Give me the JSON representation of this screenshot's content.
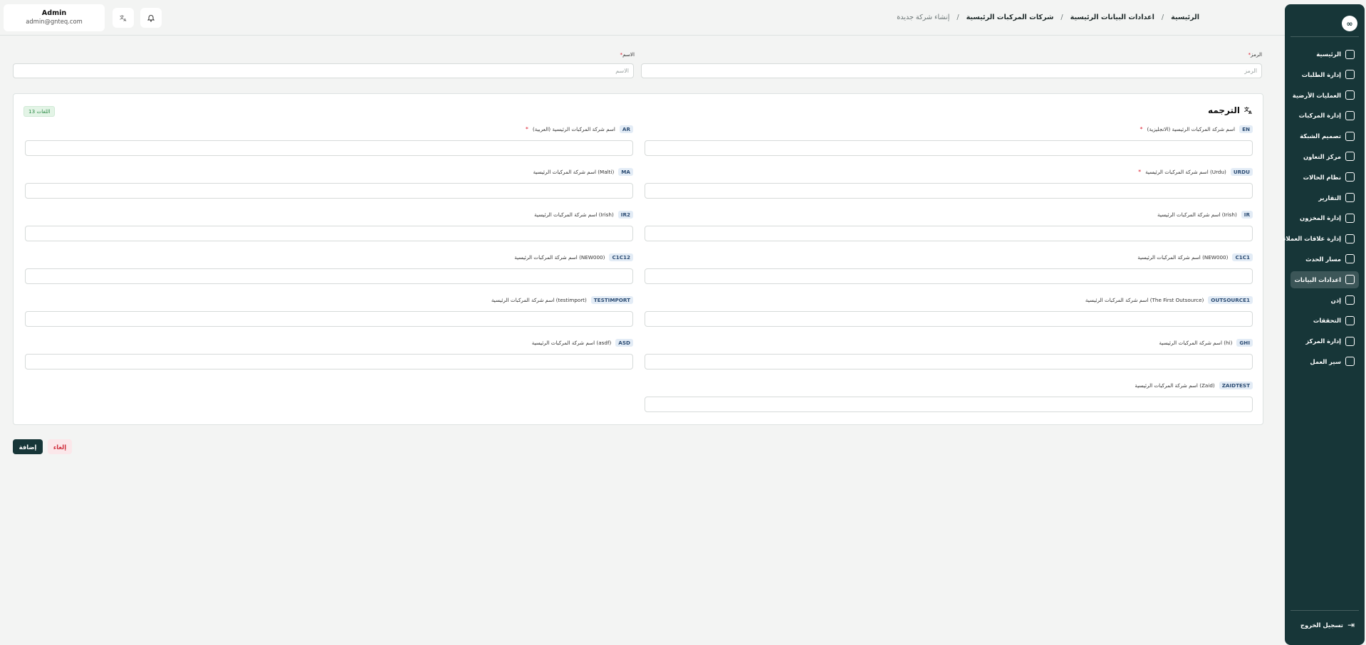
{
  "user": {
    "name": "Admin",
    "email": "admin@gnteq.com"
  },
  "topbar": {
    "translate_icon": "translate-icon",
    "bell_icon": "bell-icon"
  },
  "breadcrumb": {
    "items": [
      "الرئيسية",
      "اعدادات البيانات الرئيسية",
      "شركات المركبات الرئيسية",
      "إنشاء شركة جديدة"
    ],
    "separator": "/"
  },
  "sidebar": {
    "logo": "∞",
    "items": [
      {
        "label": "الرئيسية",
        "icon": "dashboard-icon"
      },
      {
        "label": "إدارة الطلبات",
        "icon": "orders-icon"
      },
      {
        "label": "العمليات الأرضية",
        "icon": "ground-ops-icon"
      },
      {
        "label": "إدارة المركبات",
        "icon": "truck-icon"
      },
      {
        "label": "تصميم الشبكة",
        "icon": "network-icon"
      },
      {
        "label": "مركز التعاون",
        "icon": "collab-icon"
      },
      {
        "label": "نظام الحالات",
        "icon": "status-icon"
      },
      {
        "label": "التقارير",
        "icon": "reports-icon"
      },
      {
        "label": "إدارة المخزون",
        "icon": "inventory-icon"
      },
      {
        "label": "إدارة علاقات العملاء",
        "icon": "crm-icon"
      },
      {
        "label": "مسار الحدث",
        "icon": "route-icon"
      },
      {
        "label": "اعدادات البيانات",
        "icon": "database-icon",
        "active": true
      },
      {
        "label": "إذن",
        "icon": "users-icon"
      },
      {
        "label": "التحققات",
        "icon": "validation-icon"
      },
      {
        "label": "إدارة المركز",
        "icon": "center-icon"
      },
      {
        "label": "سير العمل",
        "icon": "workflow-icon"
      }
    ],
    "logout": {
      "label": "تسجيل الخروج",
      "icon": "logout-icon"
    }
  },
  "form": {
    "code": {
      "label": "الرمز",
      "required": "*",
      "placeholder": "الرمز"
    },
    "name": {
      "label": "الاسم",
      "required": "*",
      "placeholder": "الاسم"
    }
  },
  "translation": {
    "title": "الترجمه",
    "lang_count": "13 اللغات",
    "fields": [
      {
        "badge": "EN",
        "label": "اسم شركة المركبات الرئيسية (الانجليزية)",
        "required": "*"
      },
      {
        "badge": "AR",
        "label": "اسم شركة المركبات الرئيسية (العربية)",
        "required": "*"
      },
      {
        "badge": "URDU",
        "label": "اسم شركة المركبات الرئيسية (Urdu)",
        "required": "*"
      },
      {
        "badge": "MA",
        "label": "اسم شركة المركبات الرئيسية (Malti)",
        "required": ""
      },
      {
        "badge": "IR",
        "label": "اسم شركة المركبات الرئيسية (Irish)",
        "required": ""
      },
      {
        "badge": "IR2",
        "label": "اسم شركة المركبات الرئيسية (Irish)",
        "required": ""
      },
      {
        "badge": "C1C1",
        "label": "اسم شركة المركبات الرئيسية (NEW000)",
        "required": ""
      },
      {
        "badge": "C1C12",
        "label": "اسم شركة المركبات الرئيسية (NEW000)",
        "required": ""
      },
      {
        "badge": "OUTSOURCE1",
        "label": "اسم شركة المركبات الرئيسية (The First Outsource)",
        "required": ""
      },
      {
        "badge": "TESTIMPORT",
        "label": "اسم شركة المركبات الرئيسية (testimport)",
        "required": ""
      },
      {
        "badge": "GHI",
        "label": "اسم شركة المركبات الرئيسية (hi)",
        "required": ""
      },
      {
        "badge": "ASD",
        "label": "اسم شركة المركبات الرئيسية (asdf)",
        "required": ""
      },
      {
        "badge": "ZAIDTEST",
        "label": "اسم شركة المركبات الرئيسية (Zaid)",
        "required": ""
      }
    ]
  },
  "actions": {
    "add": "إضافة",
    "cancel": "إلغاء"
  },
  "colors": {
    "sidebar": "#173638",
    "accent_required": "#dd2233",
    "lang_count_bg": "#e3f4e6"
  }
}
